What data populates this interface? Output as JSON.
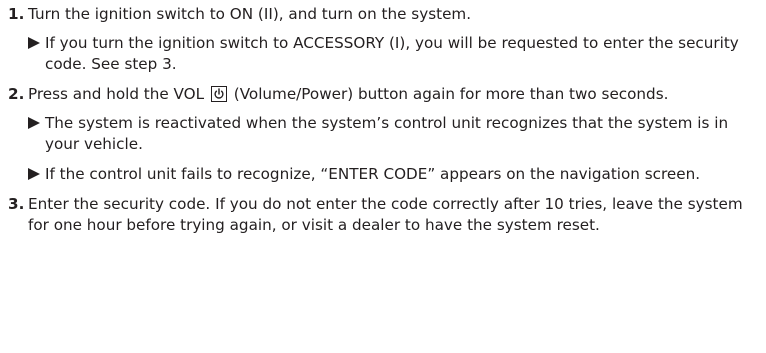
{
  "steps": [
    {
      "number": "1.",
      "text": "Turn the ignition switch to ON (II), and turn on the system.",
      "notes": [
        "If you turn the ignition switch to ACCESSORY (I), you will be requested to enter the security code. See step 3."
      ]
    },
    {
      "number": "2.",
      "text_before_icon": "Press and hold the VOL",
      "text_after_icon": "(Volume/Power) button again for more than two seconds.",
      "notes": [
        "The system is reactivated when the system’s control unit recognizes that the system is in your vehicle.",
        "If the control unit fails to recognize, “ENTER CODE” appears on the navigation screen."
      ]
    },
    {
      "number": "3.",
      "text": "Enter the security code. If you do not enter the code correctly after 10 tries, leave the system for one hour before trying again, or visit a dealer to have the system reset."
    }
  ],
  "icons": {
    "note_marker": "triangle-bullet-icon",
    "power": "power-icon"
  }
}
